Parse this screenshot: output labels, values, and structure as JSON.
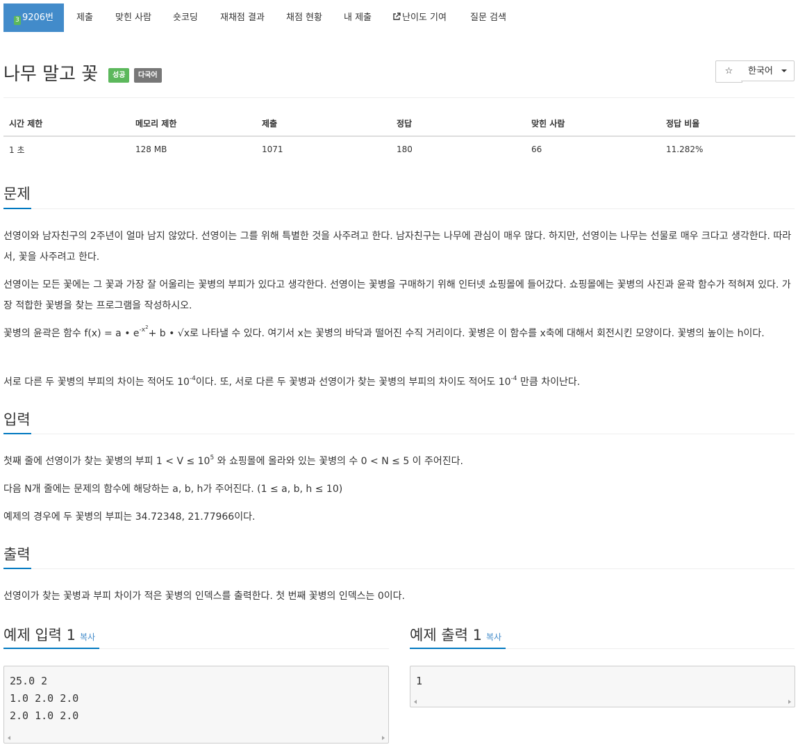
{
  "nav": {
    "problem_number": "9206번",
    "items": [
      "제출",
      "맞힌 사람",
      "숏코딩",
      "재채점 결과",
      "채점 현황",
      "내 제출",
      "난이도 기여",
      "질문 검색"
    ]
  },
  "title": "나무 말고 꽃",
  "labels": {
    "success": "성공",
    "multilang": "다국어"
  },
  "buttons": {
    "star": "☆",
    "language": "한국어"
  },
  "info_table": {
    "headers": [
      "시간 제한",
      "메모리 제한",
      "제출",
      "정답",
      "맞힌 사람",
      "정답 비율"
    ],
    "values": [
      "1 초",
      "128 MB",
      "1071",
      "180",
      "66",
      "11.282%"
    ]
  },
  "sections": {
    "problem": {
      "title": "문제",
      "p1": "선영이와 남자친구의 2주년이 얼마 남지 않았다. 선영이는 그를 위해 특별한 것을 사주려고 한다. 남자친구는 나무에 관심이 매우 많다. 하지만, 선영이는 나무는 선물로 매우 크다고 생각한다. 따라서, 꽃을 사주려고 한다.",
      "p2": "선영이는 모든 꽃에는 그 꽃과 가장 잘 어울리는 꽃병의 부피가 있다고 생각한다. 선영이는 꽃병을 구매하기 위해 인터넷 쇼핑몰에 들어갔다. 쇼핑몰에는 꽃병의 사진과 윤곽 함수가 적혀져 있다. 가장 적합한 꽃병을 찾는 프로그램을 작성하시오.",
      "p3_a": "꽃병의 윤곽은 함수 f(x) = a • e",
      "p3_sup": "-x",
      "p3_sup2": "2",
      "p3_b": "+ b • √x로 나타낼 수 있다. 여기서 x는 꽃병의 바닥과 떨어진 수직 거리이다. 꽃병은 이 함수를 x축에 대해서 회전시킨 모양이다. 꽃병의 높이는 h이다.",
      "p4_a": "서로 다른 두 꽃병의 부피의 차이는 적어도 10",
      "p4_sup": "-4",
      "p4_b": "이다. 또, 서로 다른 두 꽃병과 선영이가 찾는 꽃병의 부피의 차이도 적어도 10",
      "p4_sup2": "-4",
      "p4_c": " 만큼 차이난다."
    },
    "input": {
      "title": "입력",
      "p1_a": "첫째 줄에 선영이가 찾는 꽃병의 부피 1 < V ≤ 10",
      "p1_sup": "5",
      "p1_b": " 와 쇼핑몰에 올라와 있는 꽃병의 수 0 < N ≤ 5 이 주어진다.",
      "p2": "다음 N개 줄에는 문제의 함수에 해당하는 a, b, h가 주어진다. (1 ≤ a, b, h ≤ 10)",
      "p3": "예제의 경우에 두 꽃병의 부피는 34.72348, 21.77966이다."
    },
    "output": {
      "title": "출력",
      "p1": "선영이가 찾는 꽃병과 부피 차이가 적은 꽃병의 인덱스를 출력한다. 첫 번째 꽃병의 인덱스는 0이다."
    }
  },
  "examples": {
    "input_title": "예제 입력 1",
    "output_title": "예제 출력 1",
    "copy": "복사",
    "input_lines": [
      "25.0 2",
      "1.0 2.0 2.0",
      "2.0 1.0 2.0"
    ],
    "output_lines": [
      "1"
    ]
  }
}
